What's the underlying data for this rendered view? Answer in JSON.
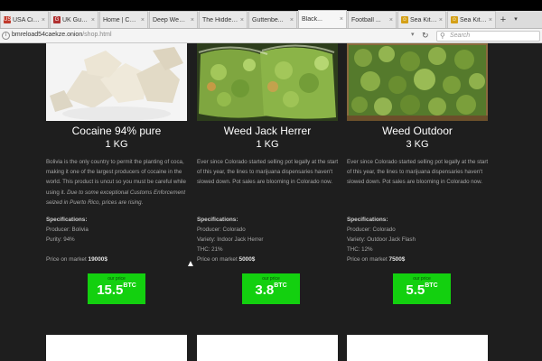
{
  "browser": {
    "tabs": [
      {
        "label": "USA Citiz...",
        "favicon": "us-flag-icon",
        "favicon_text": "US",
        "favicon_color": "#c0392b"
      },
      {
        "label": "UK Guns ...",
        "favicon": "uk-guns-icon",
        "favicon_text": "G",
        "favicon_color": "#b03030"
      },
      {
        "label": "Home | Carde...",
        "favicon": "",
        "favicon_text": "",
        "favicon_color": ""
      },
      {
        "label": "Deep Web Dir...",
        "favicon": "",
        "favicon_text": "",
        "favicon_color": ""
      },
      {
        "label": "The Hidden ...",
        "favicon": "",
        "favicon_text": "",
        "favicon_color": ""
      },
      {
        "label": "Guttenbe...",
        "favicon": "",
        "favicon_text": "",
        "favicon_color": ""
      },
      {
        "label": "Black...",
        "favicon": "",
        "favicon_text": "",
        "favicon_color": "",
        "active": true
      },
      {
        "label": "Football ...",
        "favicon": "",
        "favicon_text": "",
        "favicon_color": ""
      },
      {
        "label": "Sea Kitte...",
        "favicon": "sea-kitten-icon",
        "favicon_text": "☺",
        "favicon_color": "#d4a017"
      },
      {
        "label": "Sea Kitte...",
        "favicon": "sea-kitten-icon",
        "favicon_text": "☺",
        "favicon_color": "#d4a017"
      }
    ],
    "url_host": "bmreload54caekze.onion",
    "url_path": "/shop.html",
    "search_placeholder": "Search"
  },
  "products": [
    {
      "name": "Cocaine 94% pure",
      "qty": "1 KG",
      "desc": "Bolivia is the only country to permit the planting of coca, making it one of the largest producers of cocaine in the world. This product is uncut so you must be careful while using it.",
      "desc_em": "Due to some exceptional Customs Enforcement seized in Puerto Rico, prices are rising.",
      "spec_title": "Specifications:",
      "specs": [
        "Producer: Bolivia",
        "Purity: 94%"
      ],
      "market_label": "Price on market",
      "market_price": "19000$",
      "btc_caption": "our price",
      "btc_value": "15.5",
      "btc_unit": "BTC"
    },
    {
      "name": "Weed Jack Herrer",
      "qty": "1 KG",
      "desc": "Ever since Colorado started selling pot legally at the start of this year, the lines to marijuana dispensaries haven't slowed down. Pot sales are blooming in Colorado now.",
      "desc_em": "",
      "spec_title": "Specifications:",
      "specs": [
        "Producer: Colorado",
        "Variety: Indoor Jack Herrer",
        "THC: 21%"
      ],
      "market_label": "Price on market",
      "market_price": "5000$",
      "btc_caption": "our price",
      "btc_value": "3.8",
      "btc_unit": "BTC"
    },
    {
      "name": "Weed Outdoor",
      "qty": "3 KG",
      "desc": "Ever since Colorado started selling pot legally at the start of this year, the lines to marijuana dispensaries haven't slowed down. Pot sales are blooming in Colorado now.",
      "desc_em": "",
      "spec_title": "Specifications:",
      "specs": [
        "Producer: Colorado",
        "Variety: Outdoor Jack Flash",
        "THC: 12%"
      ],
      "market_label": "Price on market",
      "market_price": "7500$",
      "btc_caption": "our price",
      "btc_value": "5.5",
      "btc_unit": "BTC"
    }
  ],
  "colors": {
    "btc_button": "#13d00f",
    "page_bg": "#1e1e1e"
  }
}
